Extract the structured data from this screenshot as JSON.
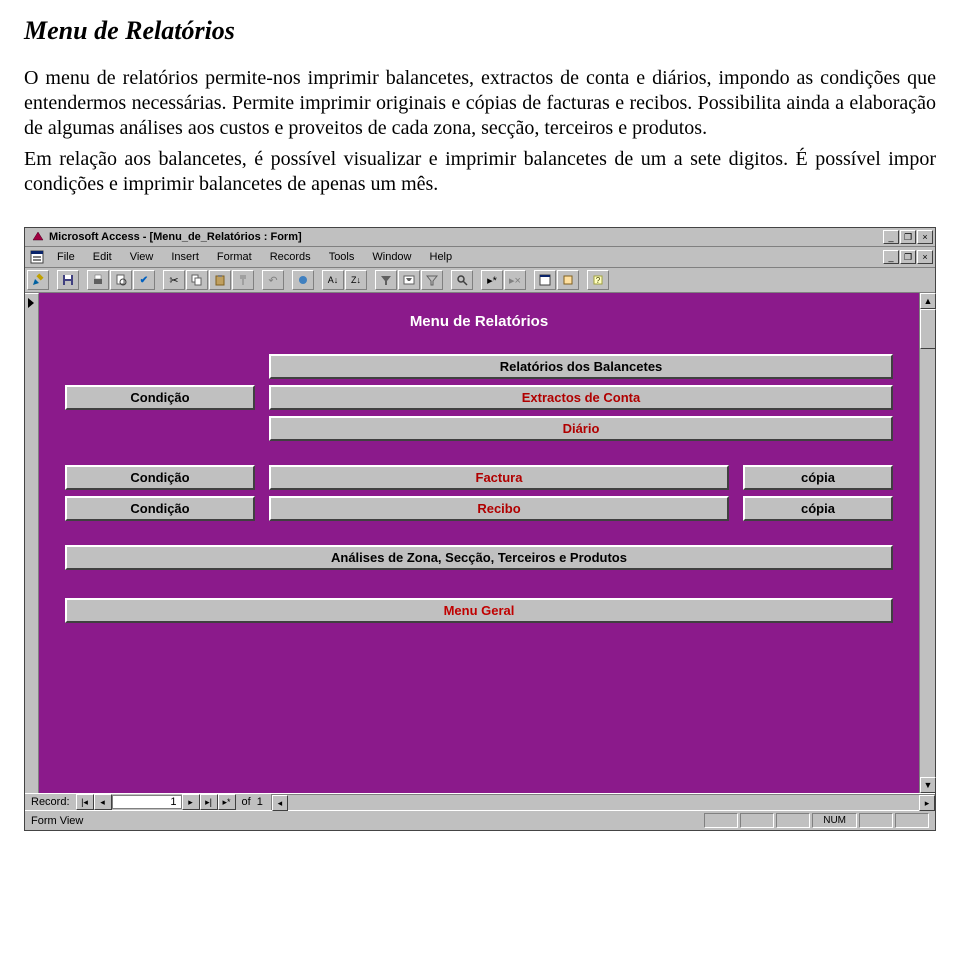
{
  "doc": {
    "title": "Menu de Relatórios",
    "p1": "O menu de relatórios permite-nos imprimir balancetes, extractos de conta e diários, impondo as condições que entendermos necessárias. Permite imprimir originais e cópias de facturas e recibos. Possibilita ainda a elaboração de algumas análises aos custos e proveitos de cada zona, secção, terceiros  e produtos.",
    "p2": "Em relação aos balancetes, é possível visualizar e imprimir balancetes de um a sete digitos. É possível impor condições e imprimir balancetes de apenas um mês."
  },
  "window": {
    "title": "Microsoft Access - [Menu_de_Relatórios : Form]"
  },
  "menubar": {
    "file": "File",
    "edit": "Edit",
    "view": "View",
    "insert": "Insert",
    "format": "Format",
    "records": "Records",
    "tools": "Tools",
    "window": "Window",
    "help": "Help"
  },
  "form": {
    "heading": "Menu de Relatórios",
    "group1": {
      "condicao": "Condição",
      "relatorios_balancetes": "Relatórios dos Balancetes",
      "extractos_conta": "Extractos de Conta",
      "diario": "Diário"
    },
    "group2": {
      "row1": {
        "condicao": "Condição",
        "factura": "Factura",
        "copia": "cópia"
      },
      "row2": {
        "condicao": "Condição",
        "recibo": "Recibo",
        "copia": "cópia"
      }
    },
    "group3": {
      "analises": "Análises de Zona, Secção, Terceiros e Produtos"
    },
    "group4": {
      "menu_geral": "Menu Geral"
    }
  },
  "recnav": {
    "label": "Record:",
    "current": "1",
    "of_label": "of",
    "total": "1"
  },
  "statusbar": {
    "left": "Form View",
    "num": "NUM"
  }
}
